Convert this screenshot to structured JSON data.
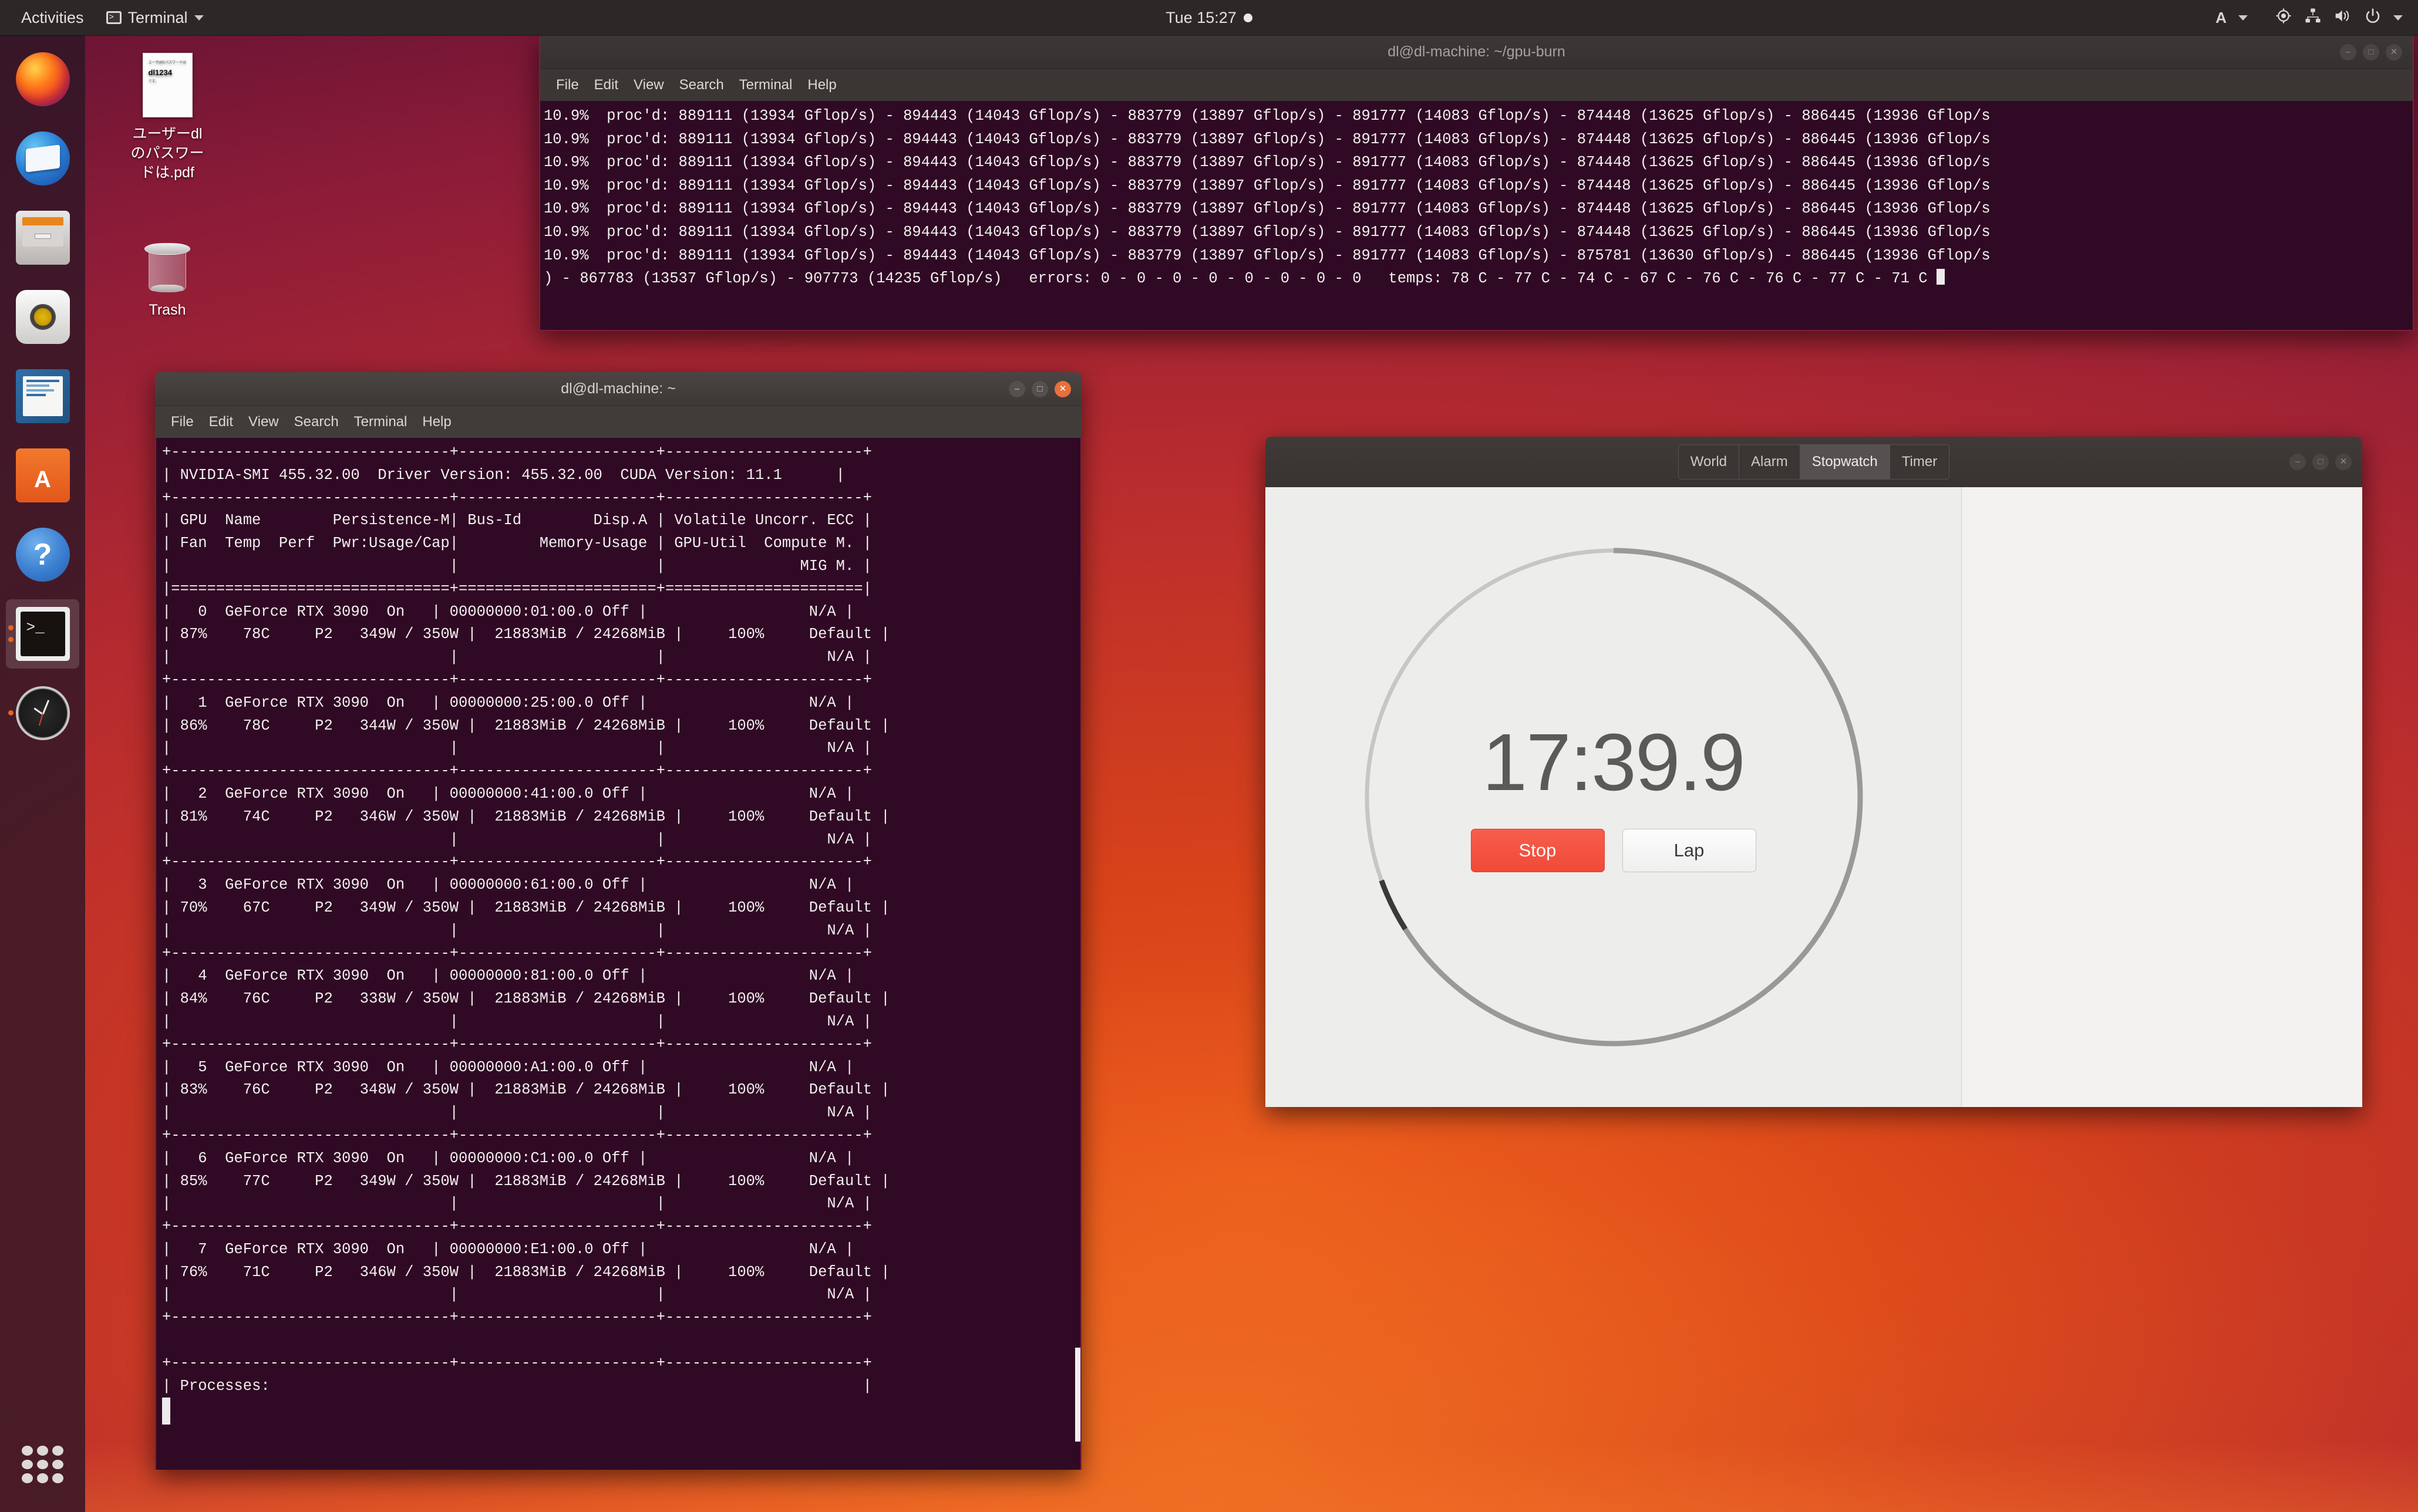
{
  "topbar": {
    "activities": "Activities",
    "app_menu": "Terminal",
    "clock": "Tue 15:27",
    "app_icon": "terminal-icon",
    "indicators": [
      "ibus-input-icon",
      "location-icon",
      "network-icon",
      "volume-icon",
      "power-icon"
    ]
  },
  "dock": {
    "items": [
      {
        "name": "firefox",
        "label": "Firefox",
        "running": false
      },
      {
        "name": "thunderbird",
        "label": "Thunderbird Mail",
        "running": false
      },
      {
        "name": "files",
        "label": "Files",
        "running": false
      },
      {
        "name": "rhythmbox",
        "label": "Rhythmbox",
        "running": false
      },
      {
        "name": "libreoffice-writer",
        "label": "LibreOffice Writer",
        "running": false
      },
      {
        "name": "ubuntu-software",
        "label": "Ubuntu Software",
        "running": false
      },
      {
        "name": "help",
        "label": "Help",
        "running": false
      },
      {
        "name": "terminal",
        "label": "Terminal",
        "running": true
      },
      {
        "name": "clocks",
        "label": "Clocks",
        "running": true
      }
    ],
    "show_apps_label": "Show Applications"
  },
  "desktop_icons": [
    {
      "name": "password-pdf",
      "label": "ユーザーdl\nのパスワー\nドは.pdf",
      "label_lines": [
        "ユーザーdl",
        "のパスワー",
        "ドは.pdf"
      ],
      "thumb_line1": "ユーザdlのパスワードは",
      "thumb_line2": "dl1234",
      "thumb_line3": "です。"
    },
    {
      "name": "trash",
      "label": "Trash",
      "label_lines": [
        "Trash"
      ]
    }
  ],
  "gpu_burn_window": {
    "title": "dl@dl-machine: ~/gpu-burn",
    "menus": [
      "File",
      "Edit",
      "View",
      "Search",
      "Terminal",
      "Help"
    ],
    "buttons": [
      "minimize",
      "maximize",
      "close"
    ],
    "lines": [
      "10.9%  proc'd: 889111 (13934 Gflop/s) - 894443 (14043 Gflop/s) - 883779 (13897 Gflop/s) - 891777 (14083 Gflop/s) - 874448 (13625 Gflop/s) - 886445 (13936 Gflop/s",
      "10.9%  proc'd: 889111 (13934 Gflop/s) - 894443 (14043 Gflop/s) - 883779 (13897 Gflop/s) - 891777 (14083 Gflop/s) - 874448 (13625 Gflop/s) - 886445 (13936 Gflop/s",
      "10.9%  proc'd: 889111 (13934 Gflop/s) - 894443 (14043 Gflop/s) - 883779 (13897 Gflop/s) - 891777 (14083 Gflop/s) - 874448 (13625 Gflop/s) - 886445 (13936 Gflop/s",
      "10.9%  proc'd: 889111 (13934 Gflop/s) - 894443 (14043 Gflop/s) - 883779 (13897 Gflop/s) - 891777 (14083 Gflop/s) - 874448 (13625 Gflop/s) - 886445 (13936 Gflop/s",
      "10.9%  proc'd: 889111 (13934 Gflop/s) - 894443 (14043 Gflop/s) - 883779 (13897 Gflop/s) - 891777 (14083 Gflop/s) - 874448 (13625 Gflop/s) - 886445 (13936 Gflop/s",
      "10.9%  proc'd: 889111 (13934 Gflop/s) - 894443 (14043 Gflop/s) - 883779 (13897 Gflop/s) - 891777 (14083 Gflop/s) - 874448 (13625 Gflop/s) - 886445 (13936 Gflop/s",
      "10.9%  proc'd: 889111 (13934 Gflop/s) - 894443 (14043 Gflop/s) - 883779 (13897 Gflop/s) - 891777 (14083 Gflop/s) - 875781 (13630 Gflop/s) - 886445 (13936 Gflop/s",
      ") - 867783 (13537 Gflop/s) - 907773 (14235 Gflop/s)   errors: 0 - 0 - 0 - 0 - 0 - 0 - 0 - 0   temps: 78 C - 77 C - 74 C - 67 C - 76 C - 76 C - 77 C - 71 C "
    ]
  },
  "nvidia_window": {
    "title": "dl@dl-machine: ~",
    "menus": [
      "File",
      "Edit",
      "View",
      "Search",
      "Terminal",
      "Help"
    ],
    "buttons": [
      "minimize",
      "maximize",
      "close"
    ],
    "smi_version": "NVIDIA-SMI 455.32.00",
    "driver_version": "Driver Version: 455.32.00",
    "cuda_version": "CUDA Version: 11.1",
    "header_row1": "| GPU  Name        Persistence-M| Bus-Id        Disp.A | Volatile Uncorr. ECC |",
    "header_row2": "| Fan  Temp  Perf  Pwr:Usage/Cap|         Memory-Usage | GPU-Util  Compute M. |",
    "header_row3": "|                               |                      |               MIG M. |",
    "rule_dash": "+-------------------------------+----------------------+----------------------+",
    "rule_eq": "|===============================+======================+======================|",
    "processes_label": "| Processes:                                                                  |",
    "gpus": [
      {
        "idx": "0",
        "name": "GeForce RTX 3090",
        "persist": "On",
        "busid": "00000000:01:00.0",
        "disp": "Off",
        "ecc": "N/A",
        "fan": "87%",
        "temp": "78C",
        "perf": "P2",
        "pwr": "349W / 350W",
        "mem": "21883MiB / 24268MiB",
        "util": "100%",
        "compute": "Default",
        "mig": "N/A"
      },
      {
        "idx": "1",
        "name": "GeForce RTX 3090",
        "persist": "On",
        "busid": "00000000:25:00.0",
        "disp": "Off",
        "ecc": "N/A",
        "fan": "86%",
        "temp": "78C",
        "perf": "P2",
        "pwr": "344W / 350W",
        "mem": "21883MiB / 24268MiB",
        "util": "100%",
        "compute": "Default",
        "mig": "N/A"
      },
      {
        "idx": "2",
        "name": "GeForce RTX 3090",
        "persist": "On",
        "busid": "00000000:41:00.0",
        "disp": "Off",
        "ecc": "N/A",
        "fan": "81%",
        "temp": "74C",
        "perf": "P2",
        "pwr": "346W / 350W",
        "mem": "21883MiB / 24268MiB",
        "util": "100%",
        "compute": "Default",
        "mig": "N/A"
      },
      {
        "idx": "3",
        "name": "GeForce RTX 3090",
        "persist": "On",
        "busid": "00000000:61:00.0",
        "disp": "Off",
        "ecc": "N/A",
        "fan": "70%",
        "temp": "67C",
        "perf": "P2",
        "pwr": "349W / 350W",
        "mem": "21883MiB / 24268MiB",
        "util": "100%",
        "compute": "Default",
        "mig": "N/A"
      },
      {
        "idx": "4",
        "name": "GeForce RTX 3090",
        "persist": "On",
        "busid": "00000000:81:00.0",
        "disp": "Off",
        "ecc": "N/A",
        "fan": "84%",
        "temp": "76C",
        "perf": "P2",
        "pwr": "338W / 350W",
        "mem": "21883MiB / 24268MiB",
        "util": "100%",
        "compute": "Default",
        "mig": "N/A"
      },
      {
        "idx": "5",
        "name": "GeForce RTX 3090",
        "persist": "On",
        "busid": "00000000:A1:00.0",
        "disp": "Off",
        "ecc": "N/A",
        "fan": "83%",
        "temp": "76C",
        "perf": "P2",
        "pwr": "348W / 350W",
        "mem": "21883MiB / 24268MiB",
        "util": "100%",
        "compute": "Default",
        "mig": "N/A"
      },
      {
        "idx": "6",
        "name": "GeForce RTX 3090",
        "persist": "On",
        "busid": "00000000:C1:00.0",
        "disp": "Off",
        "ecc": "N/A",
        "fan": "85%",
        "temp": "77C",
        "perf": "P2",
        "pwr": "349W / 350W",
        "mem": "21883MiB / 24268MiB",
        "util": "100%",
        "compute": "Default",
        "mig": "N/A"
      },
      {
        "idx": "7",
        "name": "GeForce RTX 3090",
        "persist": "On",
        "busid": "00000000:E1:00.0",
        "disp": "Off",
        "ecc": "N/A",
        "fan": "76%",
        "temp": "71C",
        "perf": "P2",
        "pwr": "346W / 350W",
        "mem": "21883MiB / 24268MiB",
        "util": "100%",
        "compute": "Default",
        "mig": "N/A"
      }
    ]
  },
  "clock_window": {
    "tabs": [
      {
        "label": "World",
        "selected": false
      },
      {
        "label": "Alarm",
        "selected": false
      },
      {
        "label": "Stopwatch",
        "selected": true
      },
      {
        "label": "Timer",
        "selected": false
      }
    ],
    "buttons": [
      "minimize",
      "maximize",
      "close"
    ],
    "stopwatch": {
      "elapsed": "17:39.9",
      "stop_label": "Stop",
      "lap_label": "Lap",
      "progress_pct": 66,
      "stop_color": "#f24a38",
      "laps": []
    }
  }
}
